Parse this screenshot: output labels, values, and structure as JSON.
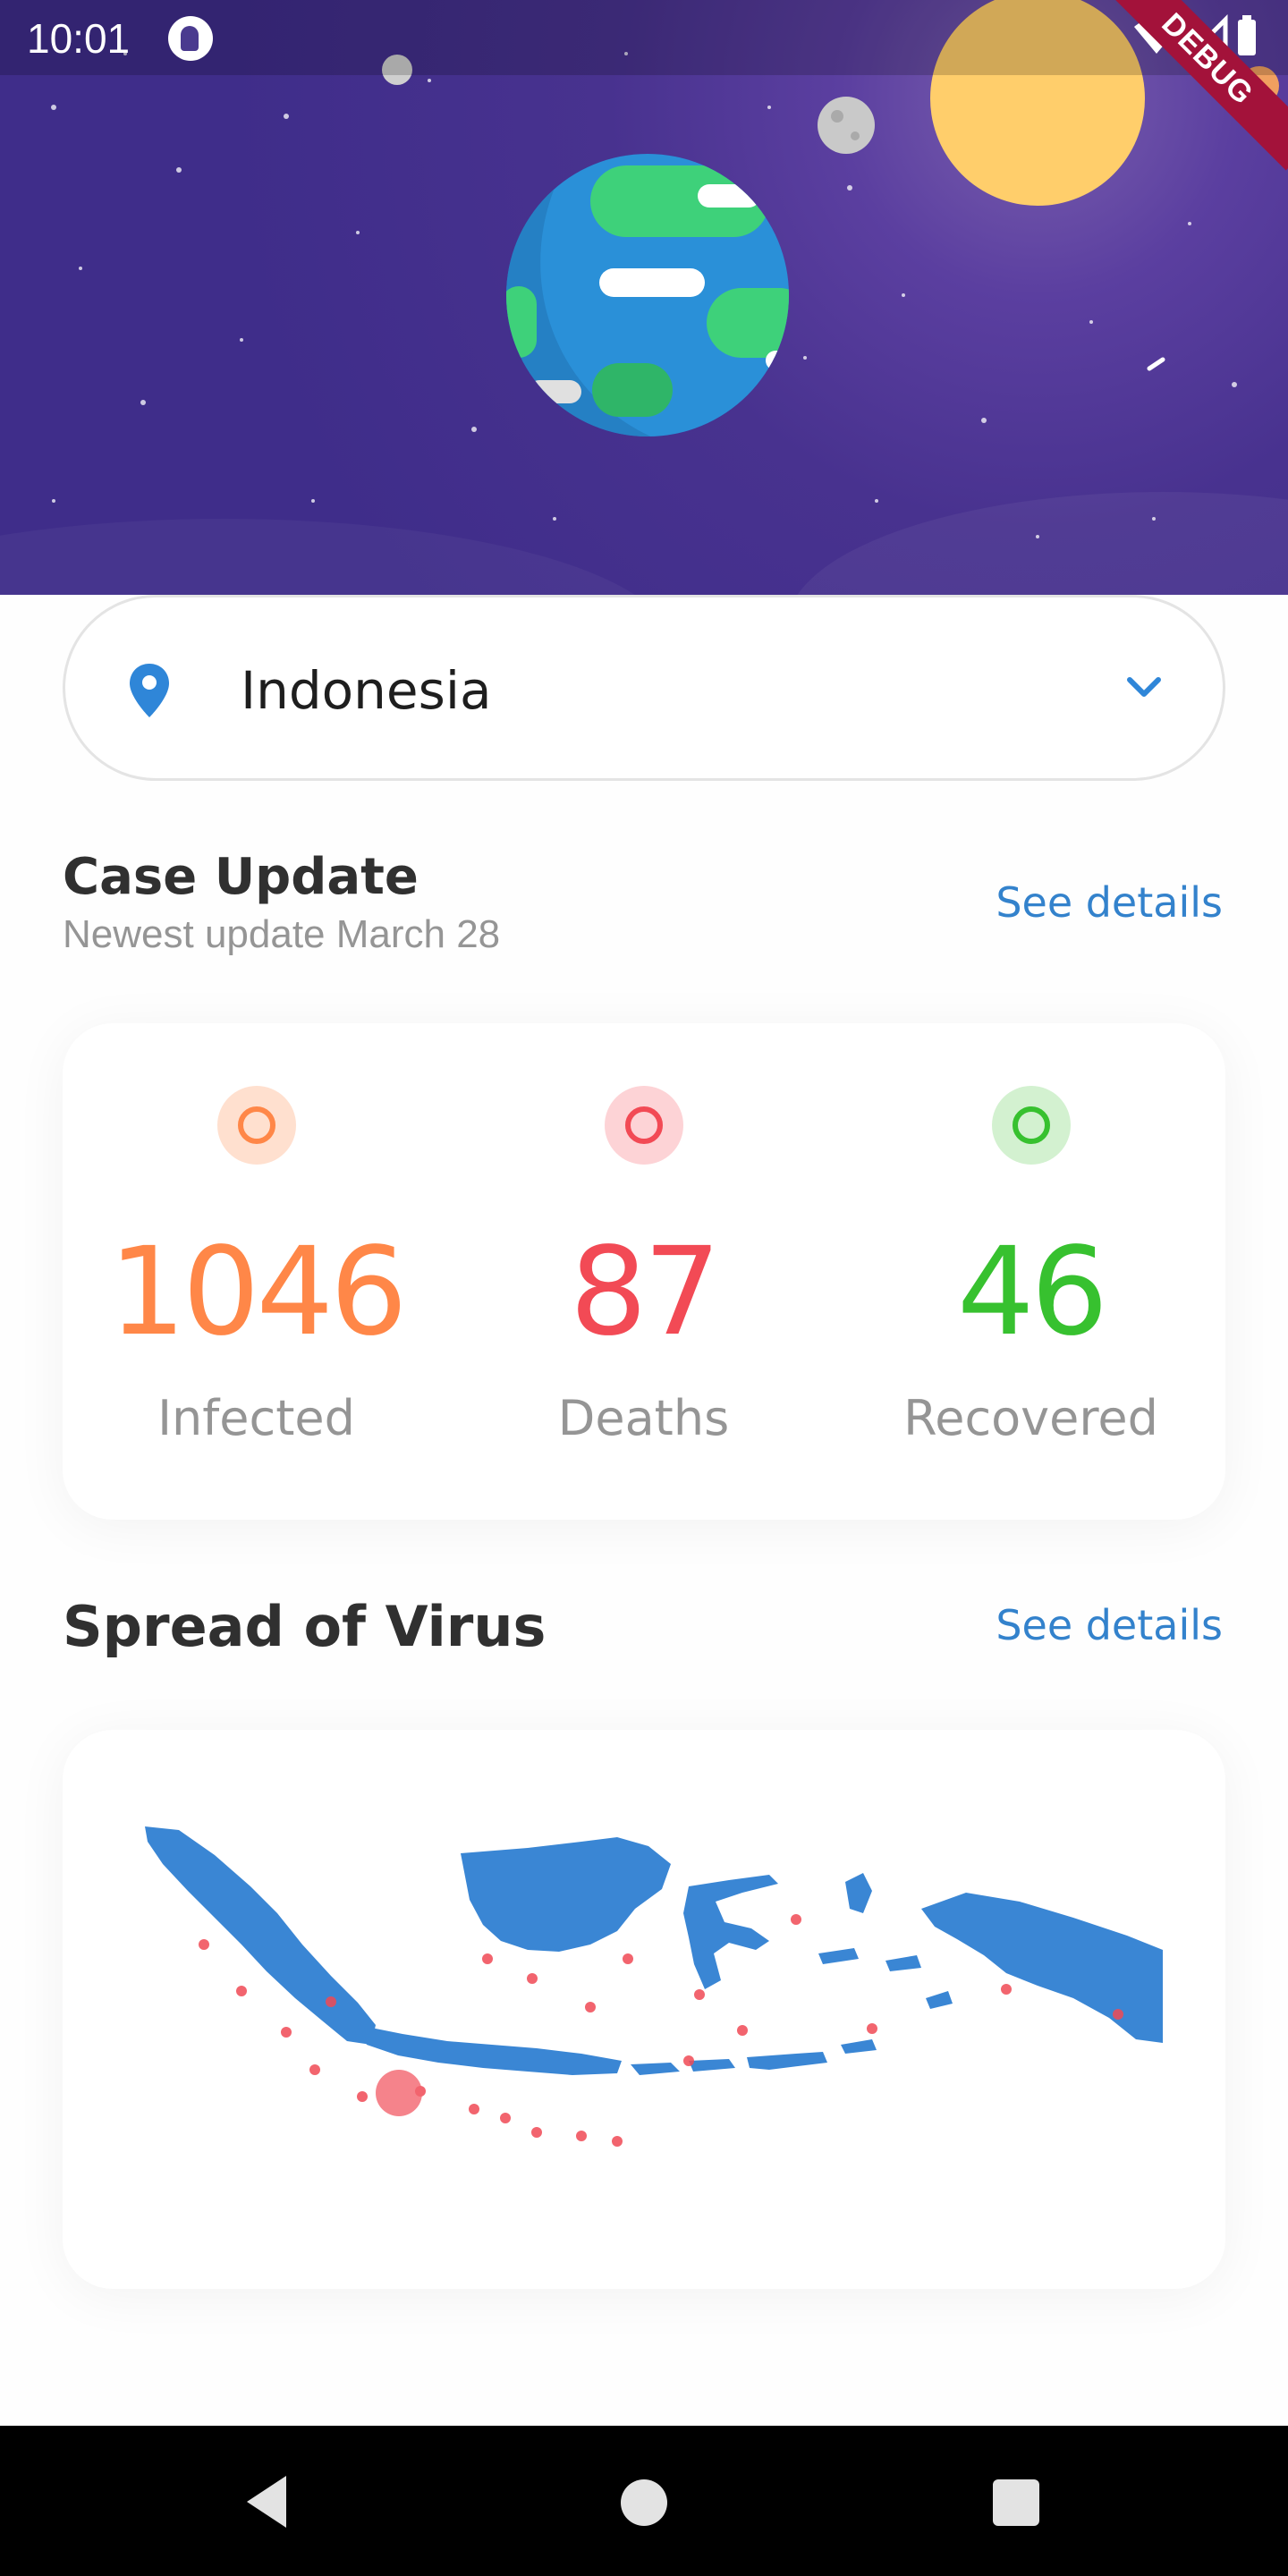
{
  "status_bar": {
    "time": "10:01",
    "icons": [
      "app-notification-icon",
      "wifi-icon",
      "signal-icon",
      "battery-icon"
    ]
  },
  "debug_banner": "DEBUG",
  "hero": {
    "theme": "space illustration with earth, moon and sun",
    "background_color": "#40308c"
  },
  "location_selector": {
    "selected_country": "Indonesia",
    "icon": "location-pin-icon",
    "dropdown_icon": "chevron-down-icon",
    "accent_color": "#2f86d8"
  },
  "case_update": {
    "title": "Case Update",
    "subtitle": "Newest update March 28",
    "see_details": "See details",
    "stats": [
      {
        "value": "1046",
        "label": "Infected",
        "color": "#ff8748",
        "bg": "#ffe0cf"
      },
      {
        "value": "87",
        "label": "Deaths",
        "color": "#f24a55",
        "bg": "#fdd3d6"
      },
      {
        "value": "46",
        "label": "Recovered",
        "color": "#37c12f",
        "bg": "#d3f1d0"
      }
    ]
  },
  "spread": {
    "title": "Spread of Virus",
    "see_details": "See details",
    "map_color": "#3a86d4",
    "hotspot_color": "#f04a55"
  },
  "nav_bar": {
    "buttons": [
      "back-button",
      "home-button",
      "recents-button"
    ]
  }
}
